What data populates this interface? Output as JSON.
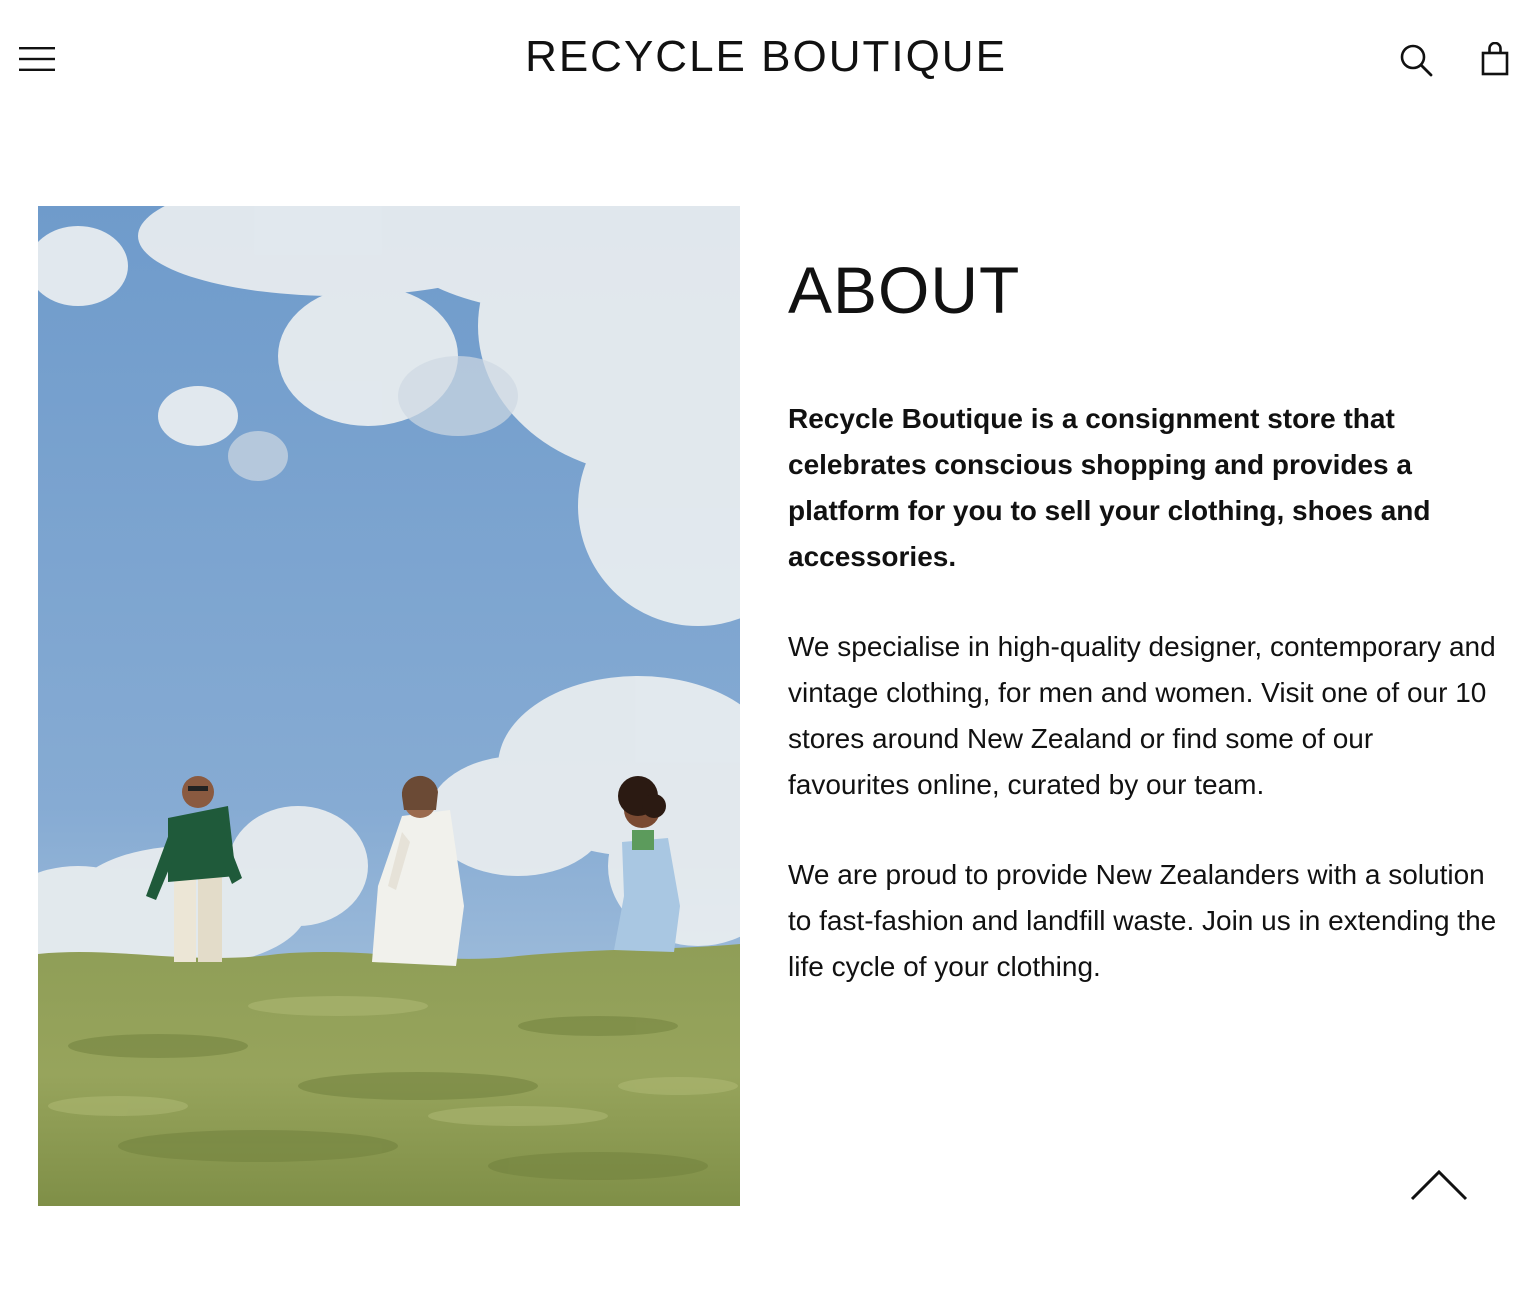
{
  "header": {
    "logo_text": "RECYCLE BOUTIQUE",
    "menu_icon": "hamburger-menu-icon",
    "search_icon": "search-icon",
    "cart_icon": "shopping-bag-icon"
  },
  "hero": {
    "icon": "photo-three-people-on-grassy-hill"
  },
  "about": {
    "title": "ABOUT",
    "intro": "Recycle Boutique is a consignment store that celebrates conscious shopping and provides a platform for you to sell your clothing, shoes and accessories.",
    "paragraph_2": "We specialise in high-quality designer, contemporary and vintage clothing, for men and women. Visit one of our 10 stores around New Zealand or find some of our favourites online, curated by our team.",
    "paragraph_3": "We are proud to provide New Zealanders with a solution to fast-fashion and landfill waste. Join us in extending the life cycle of your clothing."
  },
  "back_to_top": {
    "icon": "chevron-up-icon"
  },
  "colors": {
    "text": "#111111",
    "background": "#ffffff",
    "sky": "#7fa6cf",
    "grass": "#8a9a52"
  }
}
